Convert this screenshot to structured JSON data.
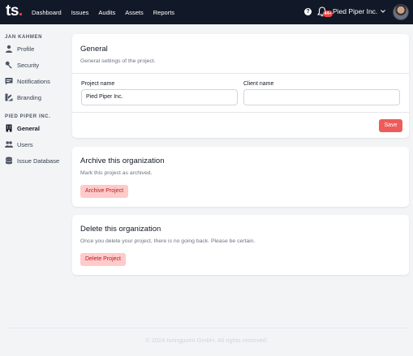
{
  "brand": {
    "logo_text": "ts",
    "logo_dot": "."
  },
  "nav": {
    "items": [
      "Dashboard",
      "Issues",
      "Audits",
      "Assets",
      "Reports"
    ]
  },
  "header": {
    "help_glyph": "?",
    "notification_count": "44+",
    "org_name": "Pied Piper Inc."
  },
  "sidebar": {
    "user_section": "JAN KAHMEN",
    "user_items": [
      "Profile",
      "Security",
      "Notifications",
      "Branding"
    ],
    "org_section": "PIED PIPER INC.",
    "org_items": [
      "General",
      "Users",
      "Issue Database"
    ]
  },
  "general": {
    "title": "General",
    "description": "General settings of the project.",
    "project_name_label": "Project name",
    "project_name_value": "Pied Piper Inc.",
    "client_name_label": "Client name",
    "client_name_value": "",
    "save_label": "Save"
  },
  "archive": {
    "title": "Archive this organization",
    "description": "Mark this project as archived.",
    "button_label": "Archive Project"
  },
  "delete": {
    "title": "Delete this organization",
    "description": "Once you delete your project, there is no going back. Please be certain.",
    "button_label": "Delete Project"
  },
  "footer": {
    "text": "© 2024 turingpoint GmbH. All rights reserved."
  },
  "colors": {
    "topbar": "#111827",
    "accent": "#ef5b5b",
    "danger_light": "#fecaca",
    "badge": "#ef4444"
  }
}
